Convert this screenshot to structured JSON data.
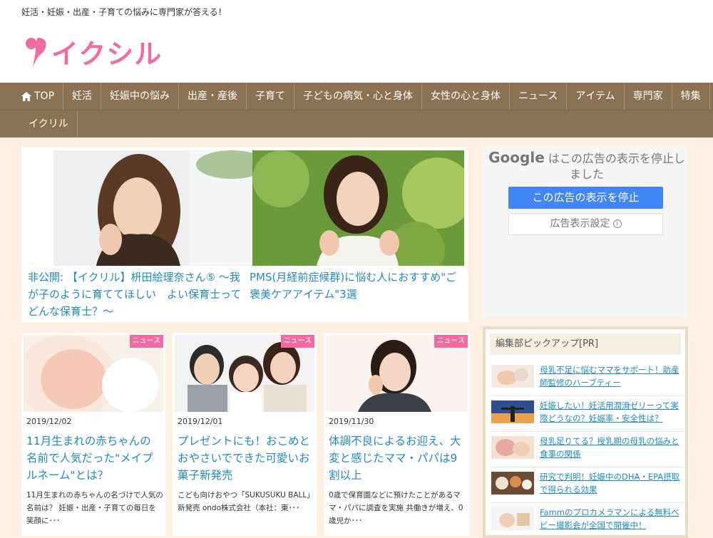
{
  "header": {
    "tagline": "妊活・妊娠・出産・子育ての悩みに専門家が答える！",
    "logo_text": "イクシル"
  },
  "nav": {
    "row1": [
      "TOP",
      "妊活",
      "妊娠中の悩み",
      "出産・産後",
      "子育て",
      "子どもの病気・心と身体",
      "女性の心と身体",
      "ニュース",
      "アイテム",
      "専門家",
      "特集"
    ],
    "row2": [
      "イクリル"
    ]
  },
  "features": [
    {
      "title": "非公開: 【イクリル】枡田絵理奈さん⑤ 〜我が子のように育ててほしい　よい保育士ってどんな保育士？〜"
    },
    {
      "title": "PMS(月経前症候群)に悩む人におすすめ\"ご褒美ケアアイテム\"3選"
    }
  ],
  "ad": {
    "brand": "Google",
    "message": "はこの広告の表示を停止しました",
    "stop_label": "この広告の表示を停止",
    "settings_label": "広告表示設定"
  },
  "cards": [
    {
      "badge": "ニュース",
      "date": "2019/12/02",
      "title": "11月生まれの赤ちゃんの名前で人気だった\"メイプルネーム\"とは？",
      "excerpt": "11月生まれの赤ちゃんの名づけで人気の名前は？ 妊娠・出産・子育ての毎日を笑顔に･･･"
    },
    {
      "badge": "ニュース",
      "date": "2019/12/01",
      "title": "プレゼントにも！おこめとおやさいでできた可愛いお菓子新発売",
      "excerpt": "こども向けおやつ「SUKUSUKU BALL」新発売 ondo株式会社（本社：東･･･"
    },
    {
      "badge": "ニュース",
      "date": "2019/11/30",
      "title": "体調不良によるお迎え、大変と感じたママ・パパは9割以上",
      "excerpt": "0歳で保育園などに預けたことがあるママ・パパに調査を実施 共働きが増え、0歳児か･･･"
    }
  ],
  "pickup": {
    "heading": "編集部ピックアップ[PR]",
    "items": [
      "母乳不足に悩むママをサポート！助産師監修のハーブティー",
      "妊娠したい！妊活用潤滑ゼリーって実際どうなの？妊娠率・安全性は？",
      "母乳足りてる？授乳期の母乳の悩みと食事の関係",
      "研究で判明！妊娠中のDHA・EPA摂取で得られる効果",
      "Fammのプロカメラマンによる無料ベビー撮影会が全国で開催中！"
    ]
  },
  "colors": {
    "accent_pink": "#ef6ba2",
    "nav_brown": "#8b7252",
    "link_blue": "#1f8bb8",
    "page_bg": "#fdf0e0"
  }
}
